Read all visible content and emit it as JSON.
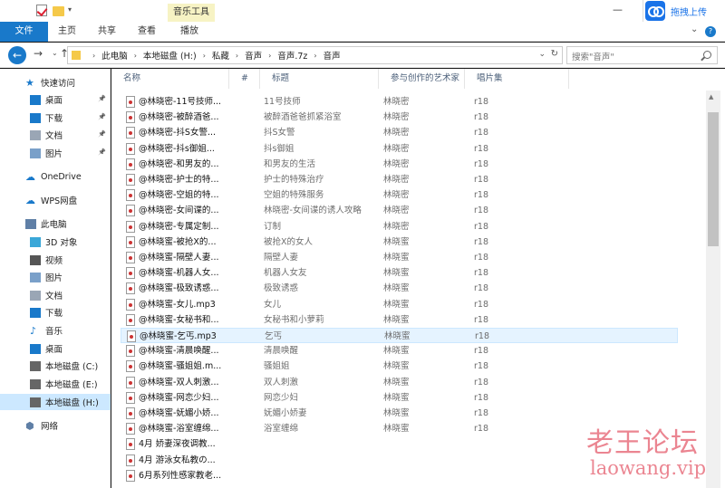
{
  "ribbon": {
    "context_tab": "音乐工具",
    "tabs": [
      "文件",
      "主页",
      "共享",
      "查看",
      "播放"
    ],
    "upload_label": "拖拽上传"
  },
  "address": {
    "crumbs": [
      "此电脑",
      "本地磁盘 (H:)",
      "私藏",
      "音声",
      "音声.7z",
      "音声"
    ],
    "search_placeholder": "搜索\"音声\""
  },
  "sidebar": {
    "items": [
      {
        "label": "快速访问",
        "icon": "star-icon",
        "pinned": false
      },
      {
        "label": "桌面",
        "icon": "desktop-icon",
        "pinned": true
      },
      {
        "label": "下载",
        "icon": "download-icon",
        "pinned": true
      },
      {
        "label": "文档",
        "icon": "document-icon",
        "pinned": true
      },
      {
        "label": "图片",
        "icon": "picture-icon",
        "pinned": true
      },
      {
        "label": "OneDrive",
        "icon": "cloud-icon",
        "pinned": false
      },
      {
        "label": "WPS网盘",
        "icon": "cloud-icon",
        "pinned": false
      },
      {
        "label": "此电脑",
        "icon": "computer-icon",
        "pinned": false
      },
      {
        "label": "3D 对象",
        "icon": "cube-icon",
        "pinned": false
      },
      {
        "label": "视频",
        "icon": "video-icon",
        "pinned": false
      },
      {
        "label": "图片",
        "icon": "picture-icon",
        "pinned": false
      },
      {
        "label": "文档",
        "icon": "document-icon",
        "pinned": false
      },
      {
        "label": "下载",
        "icon": "download-icon",
        "pinned": false
      },
      {
        "label": "音乐",
        "icon": "music-icon",
        "pinned": false
      },
      {
        "label": "桌面",
        "icon": "desktop-icon",
        "pinned": false
      },
      {
        "label": "本地磁盘 (C:)",
        "icon": "drive-icon",
        "pinned": false
      },
      {
        "label": "本地磁盘 (E:)",
        "icon": "drive-icon",
        "pinned": false
      },
      {
        "label": "本地磁盘 (H:)",
        "icon": "drive-icon",
        "pinned": false,
        "selected": true
      },
      {
        "label": "网络",
        "icon": "network-icon",
        "pinned": false
      }
    ]
  },
  "columns": [
    "名称",
    "#",
    "标题",
    "参与创作的艺术家",
    "唱片集"
  ],
  "files": [
    {
      "name": "@林晓密-11号技师...",
      "title": "11号技师",
      "artist": "林晓密",
      "album": "r18"
    },
    {
      "name": "@林晓密-被醉酒爸...",
      "title": "被醉酒爸爸抓紧浴室",
      "artist": "林晓密",
      "album": "r18"
    },
    {
      "name": "@林晓密-抖S女警...",
      "title": "抖S女警",
      "artist": "林晓密",
      "album": "r18"
    },
    {
      "name": "@林晓密-抖s御姐...",
      "title": "抖s御姐",
      "artist": "林晓密",
      "album": "r18"
    },
    {
      "name": "@林晓密-和男友的...",
      "title": "和男友的生活",
      "artist": "林晓密",
      "album": "r18"
    },
    {
      "name": "@林晓密-护士的特...",
      "title": "护士的特殊治疗",
      "artist": "林晓密",
      "album": "r18"
    },
    {
      "name": "@林晓密-空姐的特...",
      "title": "空姐的特殊服务",
      "artist": "林晓密",
      "album": "r18"
    },
    {
      "name": "@林晓密-女间谍的...",
      "title": "林晓密-女间谍的诱人攻略",
      "artist": "林晓密",
      "album": "r18"
    },
    {
      "name": "@林晓密-专属定制...",
      "title": "订制",
      "artist": "林晓密",
      "album": "r18"
    },
    {
      "name": "@林晓蜜-被抢X的...",
      "title": "被抢X的女人",
      "artist": "林晓蜜",
      "album": "r18"
    },
    {
      "name": "@林晓蜜-隔壁人妻...",
      "title": "隔壁人妻",
      "artist": "林晓蜜",
      "album": "r18"
    },
    {
      "name": "@林晓蜜-机器人女...",
      "title": "机器人女友",
      "artist": "林晓蜜",
      "album": "r18"
    },
    {
      "name": "@林晓蜜-极致诱惑...",
      "title": "极致诱惑",
      "artist": "林晓蜜",
      "album": "r18"
    },
    {
      "name": "@林晓蜜-女儿.mp3",
      "title": "女儿",
      "artist": "林晓蜜",
      "album": "r18"
    },
    {
      "name": "@林晓蜜-女秘书和...",
      "title": "女秘书和小萝莉",
      "artist": "林晓蜜",
      "album": "r18"
    },
    {
      "name": "@林晓蜜-乞丐.mp3",
      "title": "乞丐",
      "artist": "林晓蜜",
      "album": "r18",
      "selected": true
    },
    {
      "name": "@林晓蜜-清晨唤醒...",
      "title": "清晨唤醒",
      "artist": "林晓蜜",
      "album": "r18"
    },
    {
      "name": "@林晓蜜-骚姐姐.m...",
      "title": "骚姐姐",
      "artist": "林晓蜜",
      "album": "r18"
    },
    {
      "name": "@林晓蜜-双人刺激...",
      "title": "双人刺激",
      "artist": "林晓蜜",
      "album": "r18"
    },
    {
      "name": "@林晓蜜-网恋少妇...",
      "title": "网恋少妇",
      "artist": "林晓蜜",
      "album": "r18"
    },
    {
      "name": "@林晓蜜-妩媚小娇...",
      "title": "妩媚小娇妻",
      "artist": "林晓蜜",
      "album": "r18"
    },
    {
      "name": "@林晓蜜-浴室缠绵...",
      "title": "浴室缠绵",
      "artist": "林晓蜜",
      "album": "r18"
    },
    {
      "name": "4月 娇妻深夜调教...",
      "title": "",
      "artist": "",
      "album": ""
    },
    {
      "name": "4月 游泳女私教の...",
      "title": "",
      "artist": "",
      "album": ""
    },
    {
      "name": "6月系列性感家教老...",
      "title": "",
      "artist": "",
      "album": ""
    }
  ],
  "watermark": {
    "cn": "老王论坛",
    "en": "laowang.vip"
  }
}
